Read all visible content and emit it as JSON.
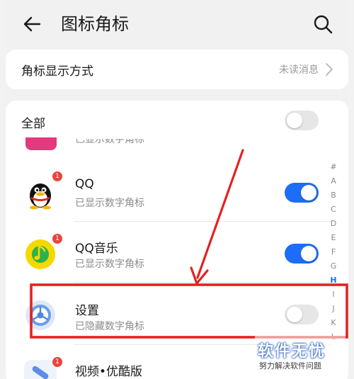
{
  "header": {
    "title": "图标角标",
    "back_icon": "arrow-left-icon",
    "search_icon": "search-icon"
  },
  "badge_mode": {
    "label": "角标显示方式",
    "value": "未读消息"
  },
  "all_toggle": {
    "label": "全部",
    "state": "off"
  },
  "partial_item_status": "已显示数字角标",
  "apps": [
    {
      "name": "QQ",
      "status": "已显示数字角标",
      "badge": "1",
      "toggle": "on",
      "icon": "qq-penguin-icon"
    },
    {
      "name": "QQ音乐",
      "status": "已显示数字角标",
      "badge": "1",
      "toggle": "on",
      "icon": "qq-music-icon"
    },
    {
      "name": "设置",
      "status": "已隐藏数字角标",
      "badge": "",
      "toggle": "off",
      "icon": "settings-gear-icon"
    },
    {
      "name": "视频•优酷版",
      "status": "",
      "badge": "1",
      "toggle": "",
      "icon": "video-icon"
    }
  ],
  "alpha_index": [
    "#",
    "A",
    "B",
    "C",
    "D",
    "E",
    "F",
    "G",
    "H",
    "I",
    "J",
    "K",
    "L"
  ],
  "alpha_index_active": "H",
  "watermark": {
    "title": "软件无忧",
    "subtitle": "努力解决软件问题"
  },
  "colors": {
    "accent": "#1e6df6",
    "annotation": "#e32222",
    "badge": "#e8453c"
  }
}
